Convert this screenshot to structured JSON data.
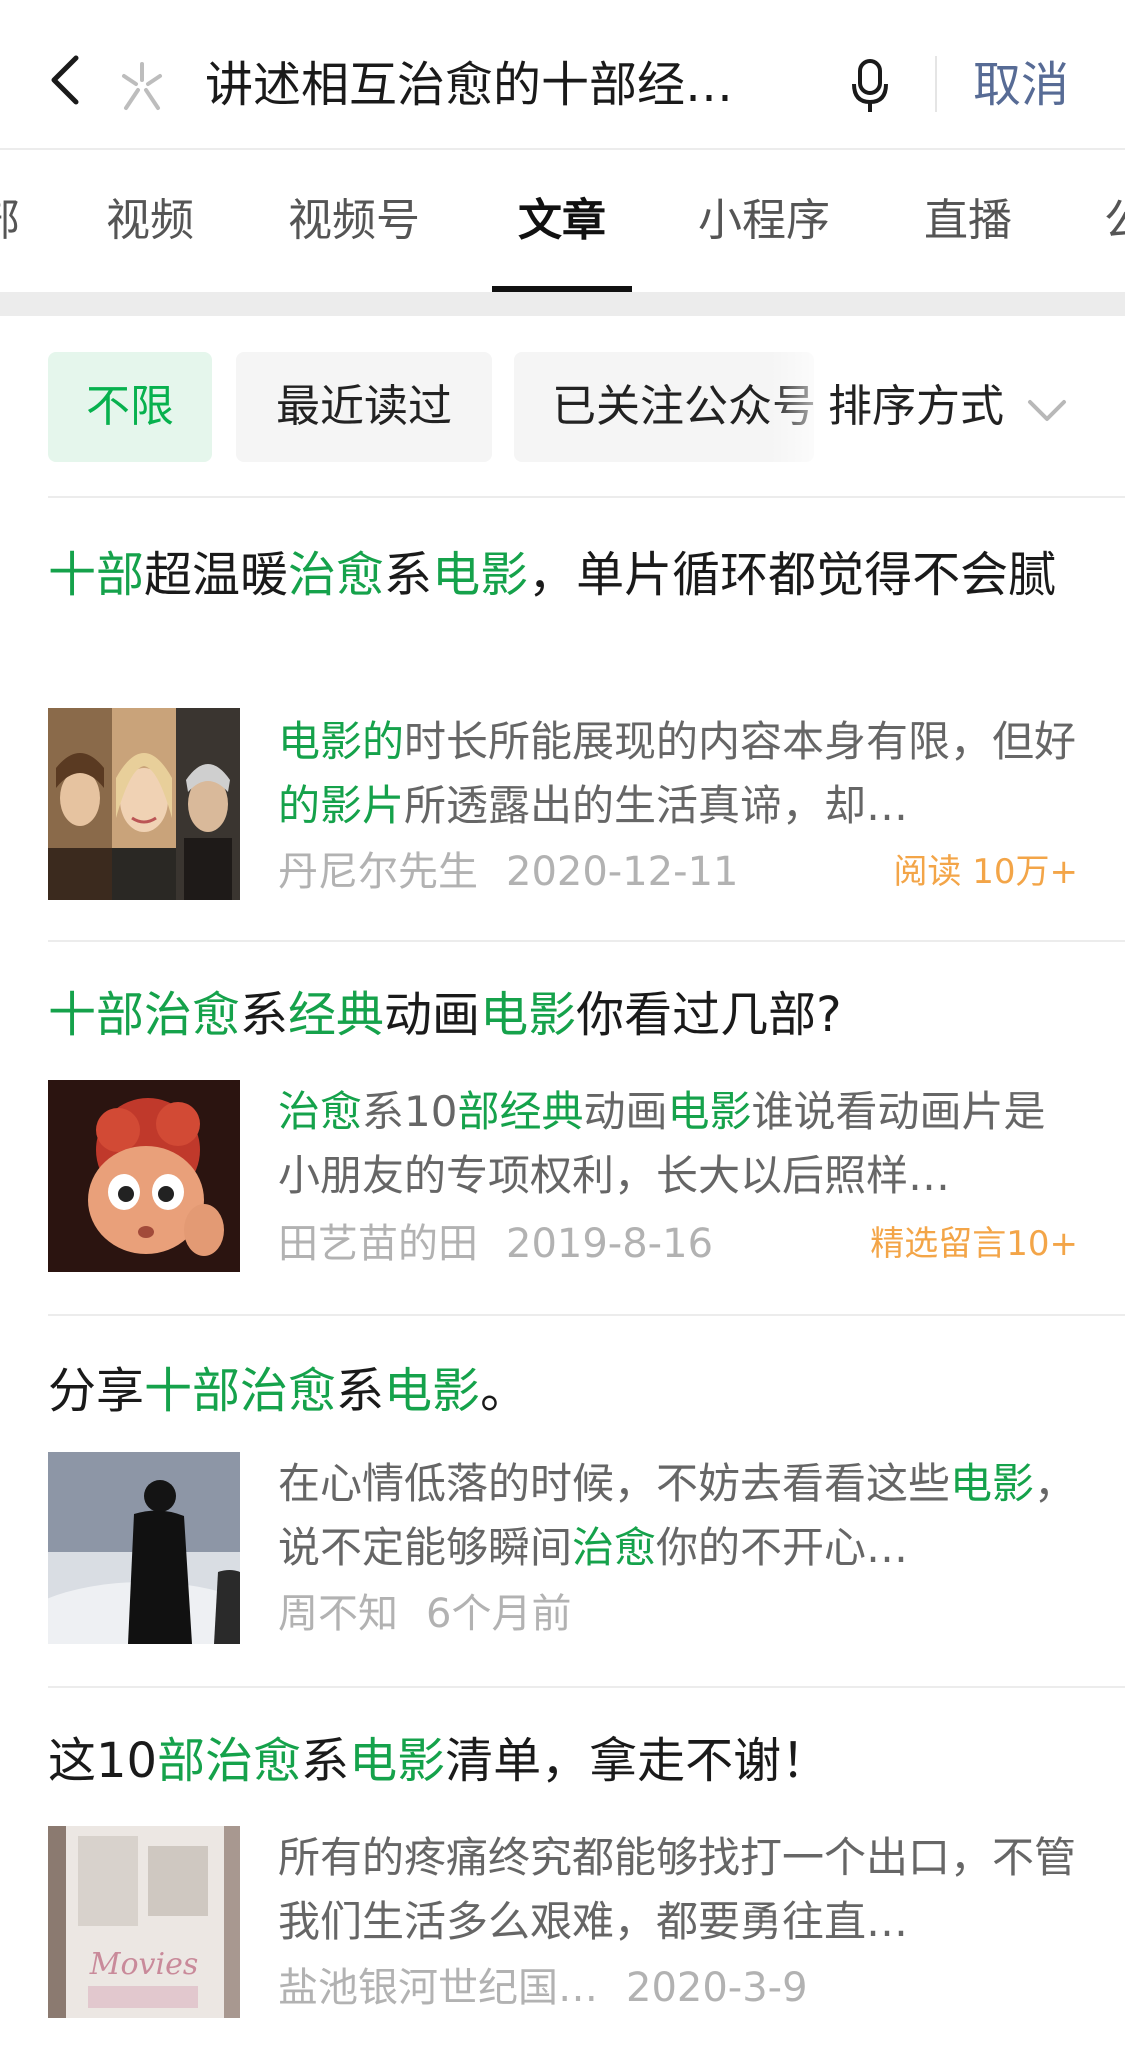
{
  "search": {
    "query": "讲述相互治愈的十部经…",
    "cancel_label": "取消"
  },
  "tabs": [
    {
      "label": "部"
    },
    {
      "label": "视频"
    },
    {
      "label": "视频号"
    },
    {
      "label": "文章",
      "active": true
    },
    {
      "label": "小程序"
    },
    {
      "label": "直播"
    },
    {
      "label": "公"
    }
  ],
  "filters": {
    "unlimited": "不限",
    "recently_read": "最近读过",
    "followed": "已关注公众号",
    "sort": "排序方式"
  },
  "colors": {
    "highlight": "#15a24b",
    "badge": "#f3a548",
    "link": "#576b95"
  },
  "articles": [
    {
      "title": [
        {
          "text": "十部",
          "hl": true
        },
        {
          "text": "超温暖",
          "hl": false
        },
        {
          "text": "治愈",
          "hl": true
        },
        {
          "text": "系",
          "hl": false
        },
        {
          "text": "电影",
          "hl": true
        },
        {
          "text": "，单片循环都觉得不会腻",
          "hl": false
        }
      ],
      "snippet": [
        {
          "text": "电影的",
          "hl": true
        },
        {
          "text": "时长所能展现的内容本身有限，但好",
          "hl": false
        },
        {
          "text": "的影片",
          "hl": true
        },
        {
          "text": "所透露出的生活真谛，却…",
          "hl": false
        }
      ],
      "author": "丹尼尔先生",
      "date": "2020-12-11",
      "badge": "阅读 10万+"
    },
    {
      "title": [
        {
          "text": "十部治愈",
          "hl": true
        },
        {
          "text": "系",
          "hl": false
        },
        {
          "text": "经典",
          "hl": true
        },
        {
          "text": "动画",
          "hl": false
        },
        {
          "text": "电影",
          "hl": true
        },
        {
          "text": "你看过几部?",
          "hl": false
        }
      ],
      "snippet": [
        {
          "text": "治愈",
          "hl": true
        },
        {
          "text": "系10",
          "hl": false
        },
        {
          "text": "部经典",
          "hl": true
        },
        {
          "text": "动画",
          "hl": false
        },
        {
          "text": "电影",
          "hl": true
        },
        {
          "text": "谁说看动画片是小朋友的专项权利，长大以后照样…",
          "hl": false
        }
      ],
      "author": "田艺苗的田",
      "date": "2019-8-16",
      "badge": "精选留言10+"
    },
    {
      "title": [
        {
          "text": "分享",
          "hl": false
        },
        {
          "text": "十部治愈",
          "hl": true
        },
        {
          "text": "系",
          "hl": false
        },
        {
          "text": "电影",
          "hl": true
        },
        {
          "text": "。",
          "hl": false
        }
      ],
      "snippet": [
        {
          "text": "在心情低落的时候，不妨去看看这些",
          "hl": false
        },
        {
          "text": "电影",
          "hl": true
        },
        {
          "text": "，说不定能够瞬间",
          "hl": false
        },
        {
          "text": "治愈",
          "hl": true
        },
        {
          "text": "你的不开心…",
          "hl": false
        }
      ],
      "author": "周不知",
      "date": "6个月前",
      "badge": ""
    },
    {
      "title": [
        {
          "text": "这10",
          "hl": false
        },
        {
          "text": "部治愈",
          "hl": true
        },
        {
          "text": "系",
          "hl": false
        },
        {
          "text": "电影",
          "hl": true
        },
        {
          "text": "清单，拿走不谢！",
          "hl": false
        }
      ],
      "snippet": [
        {
          "text": "所有的疼痛终究都能够找打一个出口，不管我们生活多么艰难，都要勇往直…",
          "hl": false
        }
      ],
      "author": "盐池银河世纪国…",
      "date": "2020-3-9",
      "badge": "",
      "thumb_text": "Movies"
    }
  ]
}
